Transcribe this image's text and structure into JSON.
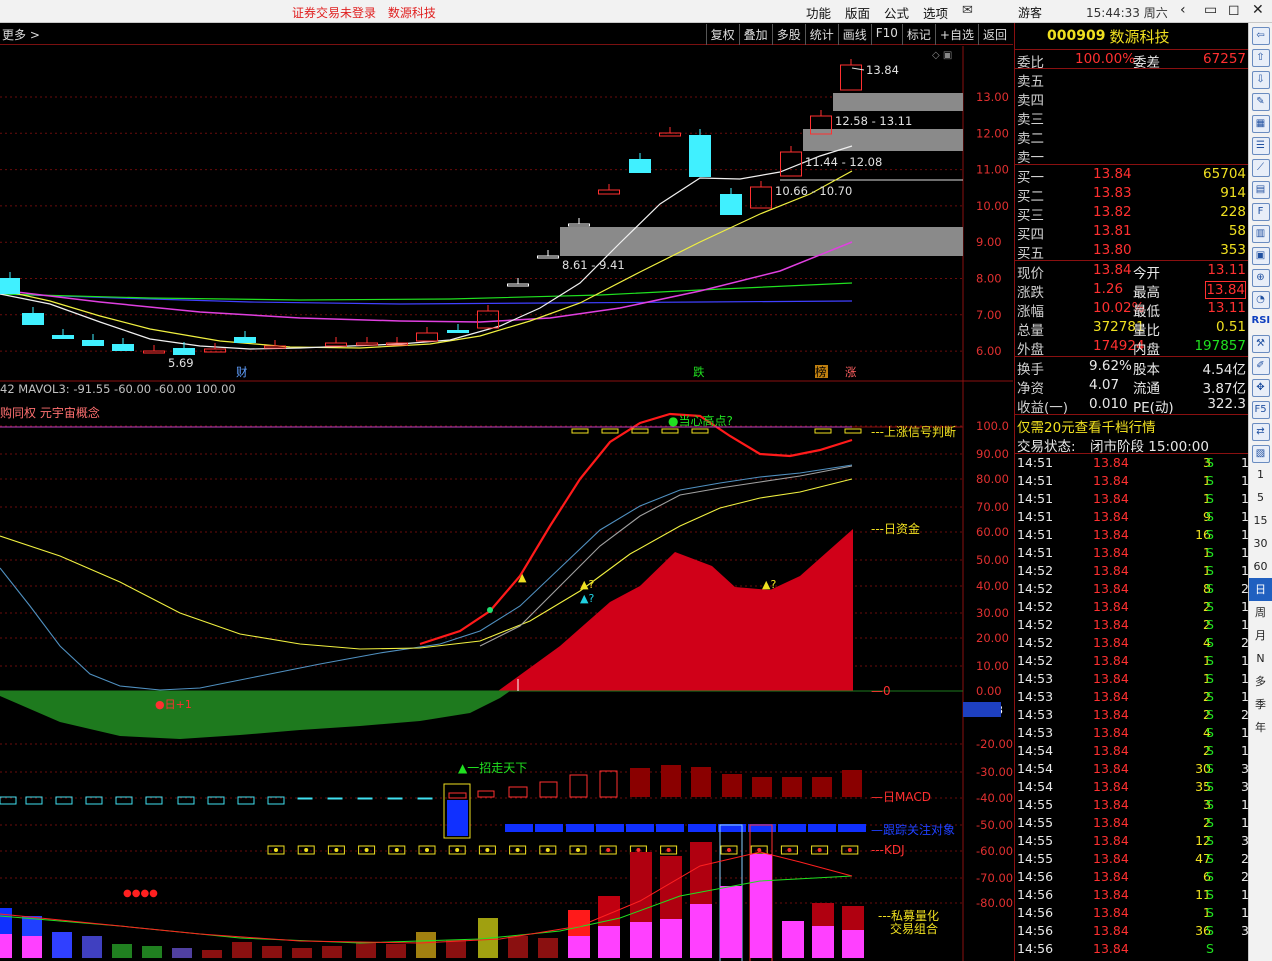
{
  "topbar": {
    "notice1": "证券交易未登录",
    "notice2": "数源科技",
    "menu": [
      "功能",
      "版面",
      "公式",
      "选项"
    ],
    "mail_icon": "envelope-icon",
    "user": "游客",
    "clock": "15:44:33 周六",
    "controls": [
      "back-icon",
      "restore-icon",
      "maximize-icon",
      "close-icon"
    ]
  },
  "toolbar": {
    "more": "更多 >",
    "buttons": [
      "复权",
      "叠加",
      "多股",
      "统计",
      "画线",
      "F10",
      "标记",
      "+自选",
      "返回"
    ]
  },
  "chart": {
    "price_axis": [
      "13.00",
      "12.00",
      "11.00",
      "10.00",
      "9.00",
      "8.00",
      "7.00",
      "6.00"
    ],
    "max_label": "13.84",
    "min_label": "5.69",
    "gap_labels": [
      "12.58 - 13.11",
      "11.44 - 12.08",
      "10.66 - 10.70",
      "8.61 - 9.41"
    ],
    "event_marks": [
      "财",
      "跌",
      "榜",
      "涨"
    ],
    "vol_line": "42  MAVOL3: -91.55  -60.00  -60.00  100.00",
    "concept_line": "购同权 元宇宙概念",
    "indicator_axis": [
      "100.0",
      "90.00",
      "80.00",
      "70.00",
      "60.00",
      "50.00",
      "40.00",
      "30.00",
      "20.00",
      "10.00",
      "0.00",
      "-10.13",
      "-20.00",
      "-30.00",
      "-40.00",
      "-50.00",
      "-60.00",
      "-70.00",
      "-80.00"
    ],
    "annotations": {
      "high_point": "●当心高点?",
      "signal": "---上涨信号判断",
      "fund": "---日资金",
      "zero": "—0",
      "bottom_mark": "●日+1",
      "one_trick": "▲一招走天下",
      "macd": "—日MACD",
      "track": "—跟踪关注对象",
      "kdj": "---KDJ",
      "quant1": "---私募量化",
      "quant2": "交易组合",
      "q1": "▲?",
      "q2": "▲?",
      "q3": "▲?"
    },
    "colors": {
      "up": "#ff3030",
      "down": "#20e0f0",
      "fund_fill": "#d00018",
      "neg_fill": "#1e7a1e",
      "grid": "#6a0c0c"
    }
  },
  "quote": {
    "code": "000909",
    "name": "数源科技",
    "weibi_label": "委比",
    "weibi": "100.00%",
    "weicha_label": "委差",
    "weicha": "67257",
    "sell": [
      {
        "label": "卖五"
      },
      {
        "label": "卖四"
      },
      {
        "label": "卖三"
      },
      {
        "label": "卖二"
      },
      {
        "label": "卖一"
      }
    ],
    "buy": [
      {
        "label": "买一",
        "price": "13.84",
        "vol": "65704"
      },
      {
        "label": "买二",
        "price": "13.83",
        "vol": "914"
      },
      {
        "label": "买三",
        "price": "13.82",
        "vol": "228"
      },
      {
        "label": "买四",
        "price": "13.81",
        "vol": "58"
      },
      {
        "label": "买五",
        "price": "13.80",
        "vol": "353"
      }
    ],
    "stats": [
      {
        "l1": "现价",
        "v1": "13.84",
        "c1": "red",
        "l2": "今开",
        "v2": "13.11",
        "c2": "red"
      },
      {
        "l1": "涨跌",
        "v1": "1.26",
        "c1": "red",
        "l2": "最高",
        "v2": "13.84",
        "c2": "red"
      },
      {
        "l1": "涨幅",
        "v1": "10.02%",
        "c1": "red",
        "l2": "最低",
        "v2": "13.11",
        "c2": "red"
      },
      {
        "l1": "总量",
        "v1": "372781",
        "c1": "yellow",
        "l2": "量比",
        "v2": "0.51",
        "c2": "yellow"
      },
      {
        "l1": "外盘",
        "v1": "174924",
        "c1": "red",
        "l2": "内盘",
        "v2": "197857",
        "c2": "green"
      }
    ],
    "stats2": [
      {
        "l1": "换手",
        "v1": "9.62%",
        "l2": "股本",
        "v2": "4.54亿"
      },
      {
        "l1": "净资",
        "v1": "4.07",
        "l2": "流通",
        "v2": "3.87亿"
      },
      {
        "l1": "收益(一)",
        "v1": "0.010",
        "l2": "PE(动)",
        "v2": "322.3"
      }
    ],
    "promo": "仅需20元查看千档行情",
    "status_label": "交易状态:",
    "status": "闭市阶段 15:00:00"
  },
  "ticks": [
    {
      "t": "14:51",
      "p": "13.84",
      "v": "3",
      "s": "S",
      "n": "1"
    },
    {
      "t": "14:51",
      "p": "13.84",
      "v": "1",
      "s": "S",
      "n": "1"
    },
    {
      "t": "14:51",
      "p": "13.84",
      "v": "1",
      "s": "S",
      "n": "1"
    },
    {
      "t": "14:51",
      "p": "13.84",
      "v": "9",
      "s": "S",
      "n": "1"
    },
    {
      "t": "14:51",
      "p": "13.84",
      "v": "16",
      "s": "S",
      "n": "1"
    },
    {
      "t": "14:51",
      "p": "13.84",
      "v": "1",
      "s": "S",
      "n": "1"
    },
    {
      "t": "14:52",
      "p": "13.84",
      "v": "1",
      "s": "S",
      "n": "1"
    },
    {
      "t": "14:52",
      "p": "13.84",
      "v": "8",
      "s": "S",
      "n": "2"
    },
    {
      "t": "14:52",
      "p": "13.84",
      "v": "2",
      "s": "S",
      "n": "1"
    },
    {
      "t": "14:52",
      "p": "13.84",
      "v": "2",
      "s": "S",
      "n": "1"
    },
    {
      "t": "14:52",
      "p": "13.84",
      "v": "4",
      "s": "S",
      "n": "2"
    },
    {
      "t": "14:52",
      "p": "13.84",
      "v": "1",
      "s": "S",
      "n": "1"
    },
    {
      "t": "14:53",
      "p": "13.84",
      "v": "1",
      "s": "S",
      "n": "1"
    },
    {
      "t": "14:53",
      "p": "13.84",
      "v": "2",
      "s": "S",
      "n": "1"
    },
    {
      "t": "14:53",
      "p": "13.84",
      "v": "2",
      "s": "S",
      "n": "2"
    },
    {
      "t": "14:53",
      "p": "13.84",
      "v": "4",
      "s": "S",
      "n": "1"
    },
    {
      "t": "14:54",
      "p": "13.84",
      "v": "2",
      "s": "S",
      "n": "1"
    },
    {
      "t": "14:54",
      "p": "13.84",
      "v": "30",
      "s": "S",
      "n": "3"
    },
    {
      "t": "14:54",
      "p": "13.84",
      "v": "35",
      "s": "S",
      "n": "3"
    },
    {
      "t": "14:55",
      "p": "13.84",
      "v": "3",
      "s": "S",
      "n": "1"
    },
    {
      "t": "14:55",
      "p": "13.84",
      "v": "2",
      "s": "S",
      "n": "1"
    },
    {
      "t": "14:55",
      "p": "13.84",
      "v": "12",
      "s": "S",
      "n": "3"
    },
    {
      "t": "14:55",
      "p": "13.84",
      "v": "47",
      "s": "S",
      "n": "2"
    },
    {
      "t": "14:56",
      "p": "13.84",
      "v": "6",
      "s": "S",
      "n": "2"
    },
    {
      "t": "14:56",
      "p": "13.84",
      "v": "11",
      "s": "S",
      "n": "1"
    },
    {
      "t": "14:56",
      "p": "13.84",
      "v": "1",
      "s": "S",
      "n": "1"
    },
    {
      "t": "14:56",
      "p": "13.84",
      "v": "36",
      "s": "S",
      "n": "3"
    },
    {
      "t": "14:56",
      "p": "13.84",
      "v": "",
      "s": "S",
      "n": ""
    }
  ],
  "side": {
    "icons": [
      "back-icon",
      "up-icon",
      "down-icon",
      "edit-icon",
      "grid-icon",
      "list-icon",
      "chart-icon",
      "table-icon",
      "f10-icon",
      "doc-icon",
      "fund-icon",
      "zoom-icon",
      "pie-icon",
      "rsi-icon",
      "tool-icon",
      "pen-icon",
      "move-icon",
      "f5-icon",
      "swap-icon",
      "multi-icon"
    ],
    "rsi": "RSI",
    "periods": [
      "1",
      "5",
      "15",
      "30",
      "60",
      "日",
      "周",
      "月",
      "N",
      "多",
      "季",
      "年"
    ]
  }
}
